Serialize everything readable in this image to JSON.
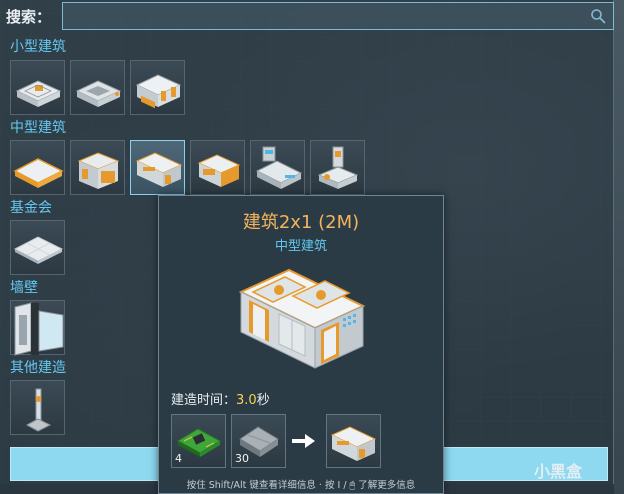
{
  "search": {
    "label": "搜索：",
    "value": "",
    "placeholder": ""
  },
  "categories": [
    {
      "title": "小型建筑",
      "items": [
        "small-building-1",
        "small-building-2",
        "small-building-3"
      ]
    },
    {
      "title": "中型建筑",
      "items": [
        "medium-building-1",
        "medium-building-2",
        "building-2x1-2m",
        "medium-building-4",
        "medium-building-5",
        "medium-building-6"
      ]
    },
    {
      "title": "基金会",
      "items": [
        "foundation"
      ]
    },
    {
      "title": "墙壁",
      "items": [
        "wall"
      ]
    },
    {
      "title": "其他建造",
      "items": [
        "other-construction"
      ]
    }
  ],
  "tooltip": {
    "title": "建筑2x1 (2M)",
    "subtitle": "中型建筑",
    "time_label": "建造时间：",
    "time_value": "3.0",
    "time_unit": "秒",
    "ingredients": [
      {
        "icon": "circuit-board-icon",
        "quantity": "4"
      },
      {
        "icon": "metal-plate-icon",
        "quantity": "30"
      }
    ],
    "result_icon": "building-2x1-icon",
    "hint": "按住 Shift/Alt 键查看详细信息 · 按 I / 🖱 了解更多信息"
  },
  "watermark": "小黑盒",
  "colors": {
    "accent": "#64c8f0",
    "title_orange": "#f3b45c",
    "time_yellow": "#f5d452",
    "bar": "#8ed8f0"
  }
}
